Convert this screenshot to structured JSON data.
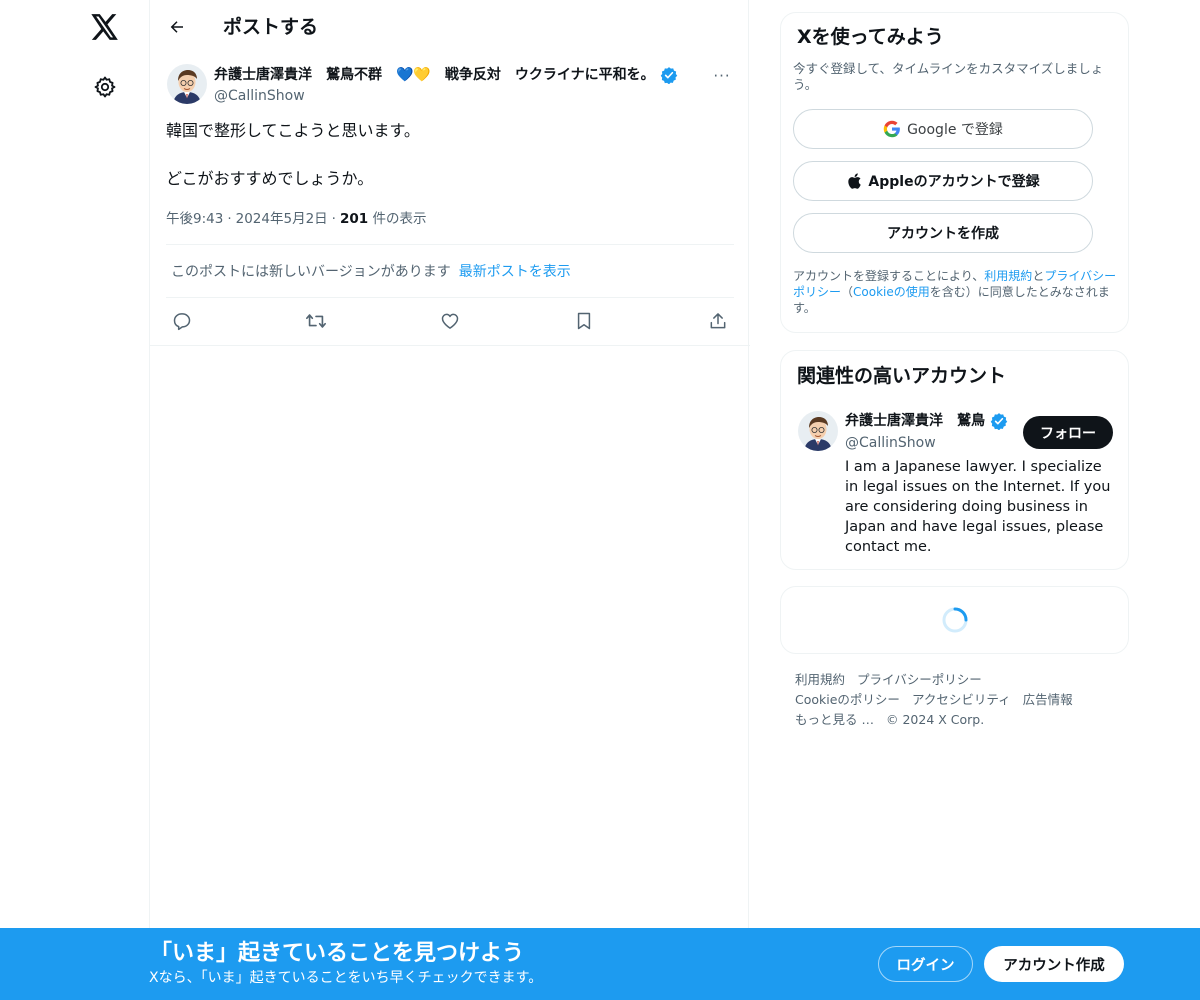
{
  "header": {
    "title": "ポストする"
  },
  "post": {
    "author_name": "弁護士唐澤貴洋　鷲鳥不群　💙💛　戦争反対　ウクライナに平和を。",
    "author_handle": "@CallinShow",
    "more": "···",
    "text_line1": "韓国で整形してこようと思います。",
    "text_line2": "どこがおすすめでしょうか。",
    "time": "午後9:43",
    "dot": "·",
    "date": "2024年5月2日",
    "views_count": "201",
    "views_label": "件の表示",
    "version_notice": "このポストには新しいバージョンがあります",
    "version_link": "最新ポストを表示"
  },
  "signup": {
    "title": "Xを使ってみよう",
    "subtitle": "今すぐ登録して、タイムラインをカスタマイズしましょう。",
    "google_label": "Google で登録",
    "apple_label": "Appleのアカウントで登録",
    "create_label": "アカウントを作成",
    "legal_prefix": "アカウントを登録することにより、",
    "legal_terms": "利用規約",
    "legal_and": "と",
    "legal_privacy": "プライバシーポリシー",
    "legal_mid": "（",
    "legal_cookie": "Cookieの使用",
    "legal_suffix": "を含む）に同意したとみなされます。"
  },
  "related": {
    "title": "関連性の高いアカウント",
    "name": "弁護士唐澤貴洋　鷲鳥",
    "handle": "@CallinShow",
    "follow_label": "フォロー",
    "bio": "I am a Japanese lawyer. I specialize in legal issues on the Internet. If you are considering doing business in Japan and have legal issues, please contact me."
  },
  "footer": {
    "terms": "利用規約",
    "privacy": "プライバシーポリシー",
    "cookie": "Cookieのポリシー",
    "accessibility": "アクセシビリティ",
    "ads": "広告情報",
    "more": "もっと見る …",
    "copyright": "© 2024 X Corp."
  },
  "banner": {
    "title": "「いま」起きていることを見つけよう",
    "subtitle": "Xなら、「いま」起きていることをいち早くチェックできます。",
    "login_label": "ログイン",
    "create_label": "アカウント作成"
  },
  "colors": {
    "accent": "#1d9bf0",
    "text": "#0f1419",
    "muted": "#536471",
    "border": "#eff3f4"
  },
  "icons": {
    "logo": "x-logo-icon",
    "settings": "gear-icon",
    "back": "arrow-left-icon",
    "verified": "verified-badge-icon",
    "reply": "reply-icon",
    "repost": "repost-icon",
    "like": "heart-icon",
    "bookmark": "bookmark-icon",
    "share": "share-icon"
  }
}
